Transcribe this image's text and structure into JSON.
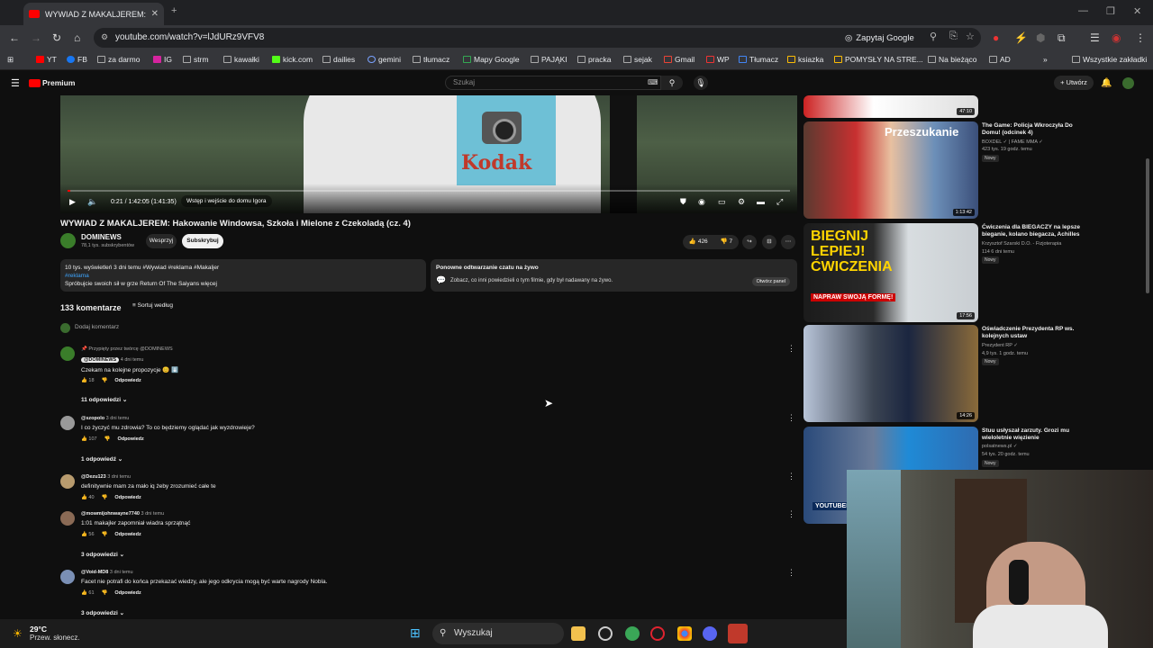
{
  "browser": {
    "tab_title": "WYWIAD Z MAKALJEREM: Hakowanie",
    "url": "youtube.com/watch?v=lJdURz9VFV8",
    "google_btn": "Zapytaj Google",
    "bookmarks": [
      "YT",
      "FB",
      "za darmo",
      "IG",
      "strm",
      "kawałki",
      "kick.com",
      "dailies",
      "gemini",
      "tłumacz",
      "Mapy Google",
      "PAJĄKI",
      "pracka",
      "sejak",
      "Gmail",
      "WP",
      "Tłumacz",
      "ksiazka",
      "POMYSŁY NA STRE...",
      "Na bieżąco",
      "AD"
    ],
    "all_bookmarks": "Wszystkie zakładki"
  },
  "yt": {
    "logo": "Premium",
    "search_placeholder": "Szukaj",
    "create": "+ Utwórz"
  },
  "video": {
    "time": "0:21 / 1:42:05 (1:41:35)",
    "chapter": "Wstęp i wejście do domu Igora",
    "progress": 0.004,
    "shirt_text": "Kodak",
    "title": "WYWIAD Z MAKALJEREM: Hakowanie Windowsa, Szkoła i Mielone z Czekoladą (cz. 4)",
    "channel": "DOMINEWS",
    "subs": "78,1 tys. subskrybentów",
    "support": "Wesprzyj",
    "subscribe": "Subskrybuj",
    "likes": "426",
    "dislikes": "7"
  },
  "desc": {
    "line1": "10 tys. wyświetleń  3 dni temu  #Wywiad #reklama #Makaljer",
    "line2": "#reklama",
    "line3": "Spróbujcie swoich sił w grze Return Of The Saiyans  więcej"
  },
  "chat": {
    "title": "Ponowne odtwarzanie czatu na żywo",
    "desc": "Zobacz, co inni powiedzieli o tym filmie, gdy był nadawany na żywo.",
    "btn": "Otwórz panel"
  },
  "comments": {
    "count": "133 komentarze",
    "sort": "Sortuj według",
    "add": "Dodaj komentarz",
    "pinned": "Przypięty przez twórcę @DOMINEWS",
    "reply": "Odpowiedz",
    "items": [
      {
        "author": "@DOMINEWS",
        "time": "4 dni temu",
        "text": "Czekam na kolejne propozycje 😊 ⬇️",
        "likes": "18",
        "replies": "11 odpowiedzi"
      },
      {
        "author": "@szopolo",
        "time": "3 dni temu",
        "text": "I co życzyć mu zdrowia? To co będziemy oglądać jak wyzdrowieje?",
        "likes": "107",
        "replies": "1 odpowiedź"
      },
      {
        "author": "@Dezu123",
        "time": "3 dni temu",
        "text": "definitywnie mam za mało iq żeby zrozumieć całe te",
        "likes": "40",
        "replies": ""
      },
      {
        "author": "@mowmijohnwayne7740",
        "time": "3 dni temu",
        "text": "1:01 makajler zapomniał wiadra sprzątnąć",
        "likes": "56",
        "replies": "3 odpowiedzi"
      },
      {
        "author": "@Void-MD8",
        "time": "3 dni temu",
        "text": "Facet nie potrafi do końca przekazać wiedzy, ale jego odkrycia mogą być warte nagrody Nobla.",
        "likes": "61",
        "replies": "3 odpowiedzi"
      }
    ]
  },
  "sidebar": [
    {
      "title": "",
      "channel": "",
      "meta": "",
      "dur": "47:10",
      "new": ""
    },
    {
      "title": "The Game: Policja Wkroczyła Do Domu! (odcinek 4)",
      "channel": "BOXDEL ✓ | FAME MMA ✓",
      "meta": "423 tys.  19 godz. temu",
      "dur": "1:13:42",
      "new": "Nowy",
      "overlay": "Przeszukanie"
    },
    {
      "title": "Ćwiczenia dla BIEGACZY na lepsze bieganie, kolano biegacza, Achilles",
      "channel": "Krzysztof Szarski D.O. - Fizjoterapia",
      "meta": "114  6 dni temu",
      "dur": "17:56",
      "new": "Nowy",
      "overlay": "BIEGNIJ LEPIEJ! ĆWICZENIA",
      "overlay2": "NAPRAW SWOJĄ FORMĘ!"
    },
    {
      "title": "Oświadczenie Prezydenta RP ws. kolejnych ustaw",
      "channel": "Prezydent RP ✓",
      "meta": "4,9 tys.  1 godz. temu",
      "dur": "14:26",
      "new": "Nowy"
    },
    {
      "title": "Stuu usłyszał zarzuty. Grozi mu wieloletnie więzienie",
      "channel": "polsatnews.pl ✓",
      "meta": "54 tys.  20 godz. temu",
      "dur": "",
      "new": "Nowy",
      "overlay": "YOUTUBER Z Z"
    }
  ],
  "taskbar": {
    "temp": "29°C",
    "weather": "Przew. słonecz.",
    "search": "Wyszukaj"
  },
  "colors": {
    "accent": "#ff0000",
    "link": "#3ea6ff",
    "bg": "#0f0f0f"
  }
}
